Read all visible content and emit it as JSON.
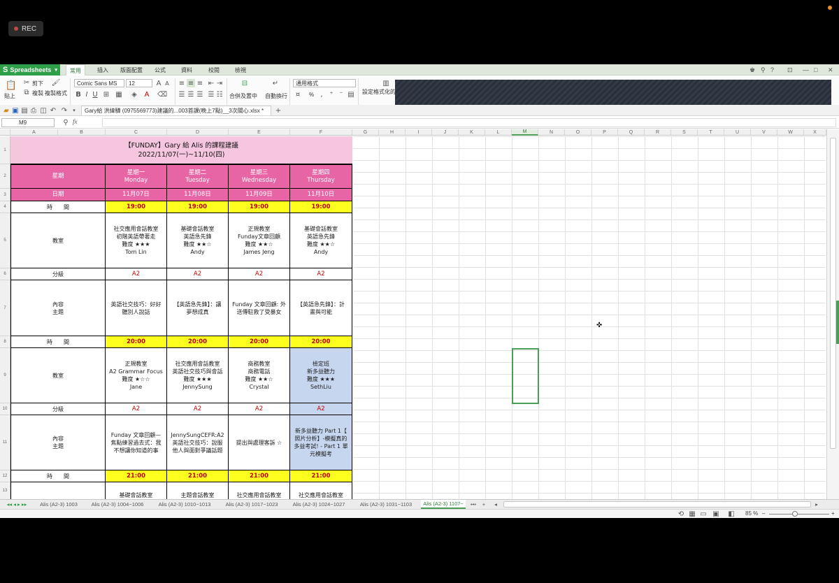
{
  "overlay": {
    "rec_label": "REC"
  },
  "app": {
    "brand": "Spreadsheets",
    "menu_tabs": [
      "常用",
      "插入",
      "版面配置",
      "公式",
      "資料",
      "校閱",
      "檢視"
    ],
    "window_controls": [
      "?",
      "—",
      "□",
      "✕"
    ]
  },
  "ribbon": {
    "cut": "剪下",
    "copy": "複製",
    "format_painter": "複製格式",
    "paste": "貼上",
    "font_name": "Comic Sans MS",
    "font_size": "12",
    "number_format": "通用格式",
    "merge_center": "合併及置中",
    "wrap_text": "自動換行",
    "conditional_format": "設定格式化的",
    "percent": "%"
  },
  "document": {
    "tab_label": "Gary給 洪緯驊 (0975569773)建議的...003首課(晚上7點)__3次關心.xlsx *"
  },
  "formula_bar": {
    "name_box": "M9",
    "fx": "fx",
    "value": ""
  },
  "columns": [
    "A",
    "B",
    "C",
    "D",
    "E",
    "F",
    "G",
    "H",
    "I",
    "J",
    "K",
    "L",
    "M",
    "N",
    "O",
    "P",
    "Q",
    "R",
    "S",
    "T",
    "U",
    "V",
    "W",
    "X"
  ],
  "rows": [
    "1",
    "2",
    "3",
    "4",
    "5",
    "6",
    "7",
    "8",
    "9",
    "10",
    "11",
    "12",
    "13"
  ],
  "sheet": {
    "title_line1": "【FUNDAY】Gary 給 Alis 的課程建議",
    "title_line2": "2022/11/07(一)~11/10(四)",
    "label_week": "星期",
    "label_date": "日期",
    "label_time": "時　　間",
    "label_classroom": "教室",
    "label_level": "分級",
    "label_topic": "內容\n主題",
    "days": [
      {
        "zh": "星期一",
        "en": "Monday",
        "date": "11月07日"
      },
      {
        "zh": "星期二",
        "en": "Tuesday",
        "date": "11月08日"
      },
      {
        "zh": "星期三",
        "en": "Wednesday",
        "date": "11月09日"
      },
      {
        "zh": "星期四",
        "en": "Thursday",
        "date": "11月10日"
      }
    ],
    "slot1": {
      "time": "19:00",
      "classrooms": [
        "社交應用會話教室\n初階英語帶著走\n難度 ★★★\nTom Lin",
        "基礎會話教室\n英語急先鋒\n難度 ★★☆\nAndy",
        "正規教室\nFunday文章回顧\n難度 ★★☆\nJames Jeng",
        "基礎會話教室\n英語急先鋒\n難度 ★★☆\nAndy"
      ],
      "levels": [
        "A2",
        "A2",
        "A2",
        "A2"
      ],
      "topics": [
        "英語社交技巧：好好\n聽別人說話",
        "【英語急先鋒】：讓\n夢想成真",
        "Funday 文章回顧: 外\n送傳駐救了受暴女",
        "【英語急先鋒】：計\n畫與可能"
      ]
    },
    "slot2": {
      "time": "20:00",
      "classrooms": [
        "正規教室\nA2 Grammar Focus\n難度 ★☆☆\nJane",
        "社交應用會話教室\n英語社交技巧與會話\n難度 ★★★\nJennySung",
        "商務教室\n商務電話\n難度 ★★☆\nCrystal",
        "檢定班\n新多益聽力\n難度 ★★★\nSethLiu"
      ],
      "levels": [
        "A2",
        "A2",
        "A2",
        "A2"
      ],
      "topics": [
        "Funday 文章回顧—\n焦點練習過去式：我\n不想讓你知道的事",
        "JennySungCEFR:A2\n英語社交技巧：說服\n他人與面對爭議話題",
        "提出與處理客訴 ☆",
        "新多益聽力 Part 1【\n照片分析】-模擬真的\n多益考試! - Part 1 單\n元模擬考"
      ]
    },
    "slot3": {
      "time": "21:00",
      "classrooms_partial": [
        "基礎會話教室",
        "主題會話教室",
        "社交應用會話教室",
        "社交應用會話教室"
      ]
    }
  },
  "sheet_tabs": [
    "Alis (A2-3) 1003",
    "Alis (A2-3) 1004~1006",
    "Alis (A2-3) 1010~1013",
    "Alis (A2-3) 1017~1023",
    "Alis (A2-3) 1024~1027",
    "Alis (A2-3) 1031~1103",
    "Alis (A2-3) 1107~"
  ],
  "status": {
    "zoom": "85 %"
  },
  "colors": {
    "pink_header": "#e865a5",
    "title_bg": "#f5c6de",
    "time_bg": "#ffff1f",
    "level_red": "#c00000",
    "highlight_blue": "#c5d6ee",
    "accent_green": "#2f9f4a"
  }
}
